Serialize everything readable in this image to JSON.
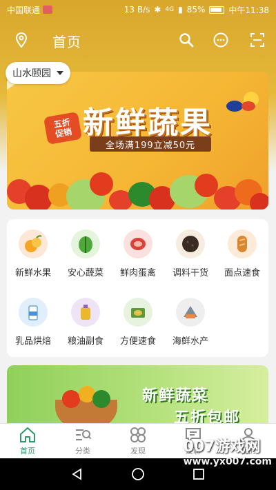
{
  "status_bar": {
    "carrier": "中国联通",
    "speed": "13 B/s",
    "signal": "4G",
    "battery": "85%",
    "time": "中午11:38"
  },
  "header": {
    "title": "首页",
    "icons": [
      "location-icon",
      "search-icon",
      "message-icon",
      "scan-icon"
    ]
  },
  "location": {
    "name": "山水颐园"
  },
  "banner": {
    "title": "新鲜蔬果",
    "badge_line1": "五折",
    "badge_line2": "促销",
    "promo": "全场满199立减50元"
  },
  "categories": [
    {
      "label": "新鲜水果",
      "icon": "fruit-icon",
      "color": "#fde7d6"
    },
    {
      "label": "安心蔬菜",
      "icon": "vegetable-icon",
      "color": "#e5f4dc"
    },
    {
      "label": "鲜肉蛋禽",
      "icon": "meat-icon",
      "color": "#fbe0e0"
    },
    {
      "label": "调料干货",
      "icon": "spice-icon",
      "color": "#f6ecdf"
    },
    {
      "label": "面点速食",
      "icon": "bread-icon",
      "color": "#fdebd7"
    },
    {
      "label": "乳品烘焙",
      "icon": "dairy-icon",
      "color": "#e1eefc"
    },
    {
      "label": "粮油副食",
      "icon": "oil-icon",
      "color": "#efe3f6"
    },
    {
      "label": "方便速食",
      "icon": "instant-food-icon",
      "color": "#e7f2df"
    },
    {
      "label": "海鲜水产",
      "icon": "seafood-icon",
      "color": "#eeeeee"
    }
  ],
  "banner2": {
    "line1": "新鲜蔬菜",
    "line2": "五折包邮"
  },
  "tabs": [
    {
      "label": "首页",
      "icon": "home-icon",
      "active": true
    },
    {
      "label": "分类",
      "icon": "category-icon",
      "active": false
    },
    {
      "label": "发现",
      "icon": "discover-icon",
      "active": false
    },
    {
      "label": "友聊",
      "icon": "chat-icon",
      "active": false
    },
    {
      "label": "我的",
      "icon": "profile-icon",
      "active": false
    }
  ],
  "watermark": {
    "line1": "007游戏网",
    "line2": "www.yx007.com"
  },
  "colors": {
    "header_bg": "#d8a72c",
    "active_tab": "#2f9a6a",
    "banner_bg": "#f7c744"
  }
}
